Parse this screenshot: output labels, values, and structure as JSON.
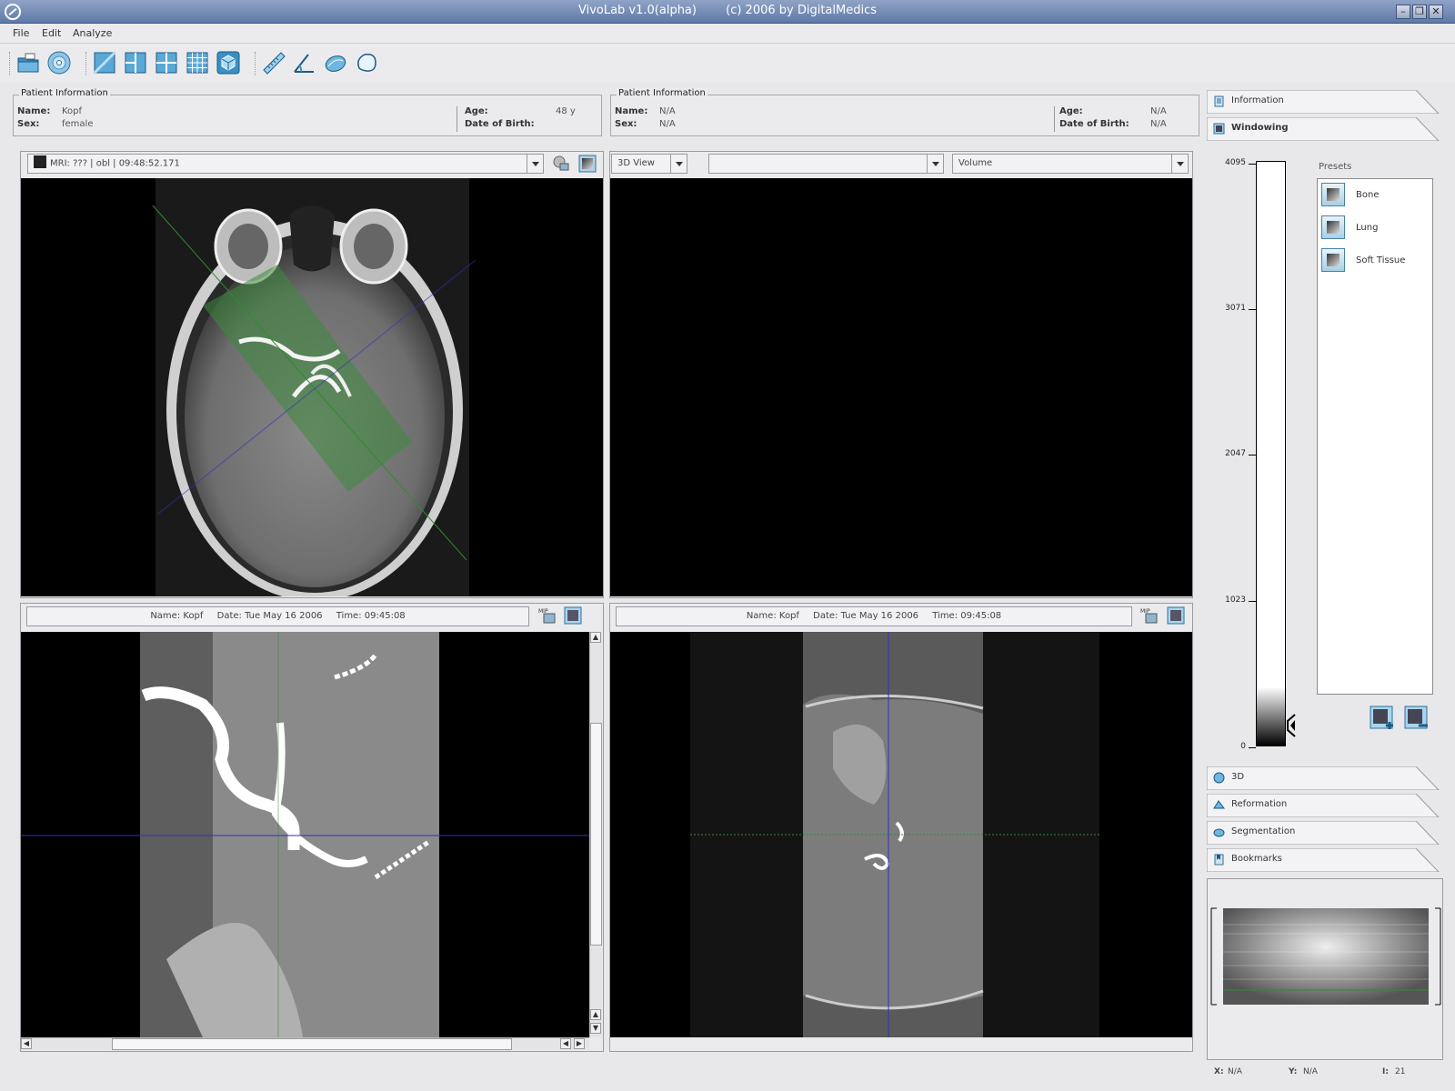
{
  "window": {
    "title_app": "VivoLab v1.0(alpha)",
    "title_copyright": "(c) 2006 by DigitalMedics"
  },
  "menu": [
    "File",
    "Edit",
    "Analyze"
  ],
  "toolbar_icons": [
    "open-folder-icon",
    "cd-icon",
    "layout-single-icon",
    "layout-split-icon",
    "layout-quad-icon",
    "layout-grid-icon",
    "3d-cube-icon",
    "ruler-icon",
    "angle-icon",
    "segment-icon",
    "lasso-icon"
  ],
  "patient_left": {
    "legend": "Patient Information",
    "name_label": "Name:",
    "name": "Kopf",
    "sex_label": "Sex:",
    "sex": "female",
    "age_label": "Age:",
    "age": "48 y",
    "dob_label": "Date of Birth:",
    "dob": ""
  },
  "patient_right": {
    "legend": "Patient Information",
    "name_label": "Name:",
    "name": "N/A",
    "sex_label": "Sex:",
    "sex": "N/A",
    "age_label": "Age:",
    "age": "N/A",
    "dob_label": "Date of Birth:",
    "dob": "N/A"
  },
  "viewport_tl": {
    "series": "MRI: ??? | obl | 09:48:52.171"
  },
  "viewport_tr": {
    "view_mode": "3D View",
    "secondary": "",
    "render_mode": "Volume"
  },
  "viewport_bl": {
    "name": "Name: Kopf",
    "date": "Date: Tue May 16 2006",
    "time": "Time: 09:45:08"
  },
  "viewport_br": {
    "name": "Name: Kopf",
    "date": "Date: Tue May 16 2006",
    "time": "Time: 09:45:08"
  },
  "side": {
    "tab_information": "Information",
    "tab_windowing": "Windowing",
    "tab_3d": "3D",
    "tab_reformation": "Reformation",
    "tab_segmentation": "Segmentation",
    "tab_bookmarks": "Bookmarks",
    "scale_labels": [
      "4095",
      "3071",
      "2047",
      "1023",
      "0"
    ],
    "presets_title": "Presets",
    "presets": [
      "Bone",
      "Lung",
      "Soft Tissue"
    ]
  },
  "status": {
    "x_label": "X:",
    "x": "N/A",
    "y_label": "Y:",
    "y": "N/A",
    "i_label": "I:",
    "i": "21"
  },
  "colors": {
    "titlebar": "#6f88b4",
    "accent": "#4a80a8",
    "crosshair_green": "#2e8b2e",
    "crosshair_blue": "#3030c0"
  }
}
